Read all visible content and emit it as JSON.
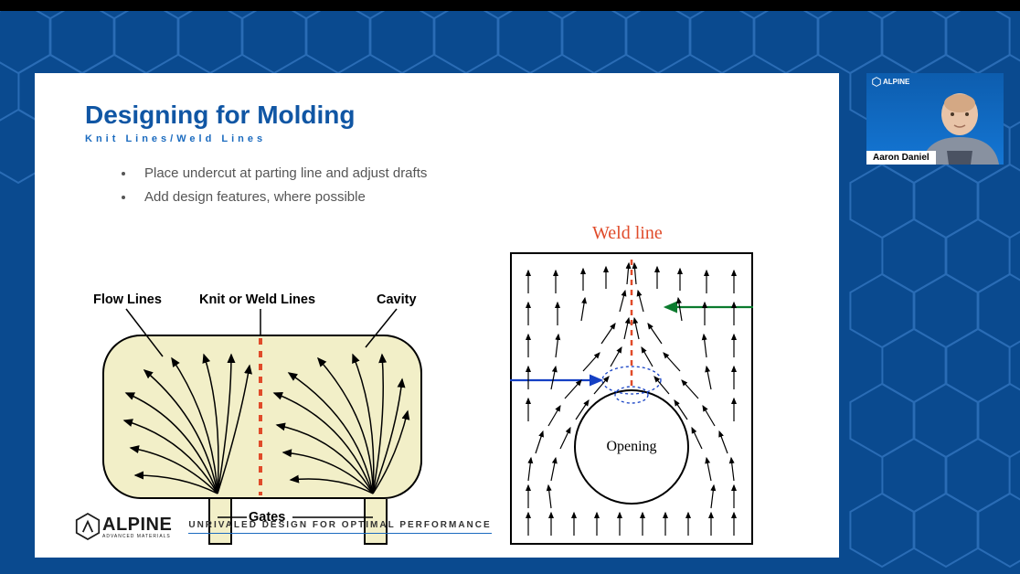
{
  "slide": {
    "title": "Designing for Molding",
    "subtitle": "Knit Lines/Weld Lines",
    "bullets": [
      "Place undercut at parting line and adjust drafts",
      "Add design features, where possible"
    ],
    "tagline": "UNRIVALED DESIGN FOR OPTIMAL PERFORMANCE",
    "logo": {
      "name": "ALPINE",
      "sub": "ADVANCED MATERIALS"
    }
  },
  "diagram_left": {
    "labels": {
      "flow_lines": "Flow Lines",
      "knit_weld": "Knit or Weld Lines",
      "cavity": "Cavity",
      "gates": "Gates"
    }
  },
  "diagram_right": {
    "title": "Weld line",
    "opening_label": "Opening"
  },
  "webcam": {
    "speaker_name": "Aaron Daniel",
    "brand": "ALPINE"
  },
  "colors": {
    "brand_blue": "#0a4a8f",
    "title_blue": "#1056a4",
    "accent_orange": "#e04b2a",
    "cavity_fill": "#f2efc8"
  }
}
